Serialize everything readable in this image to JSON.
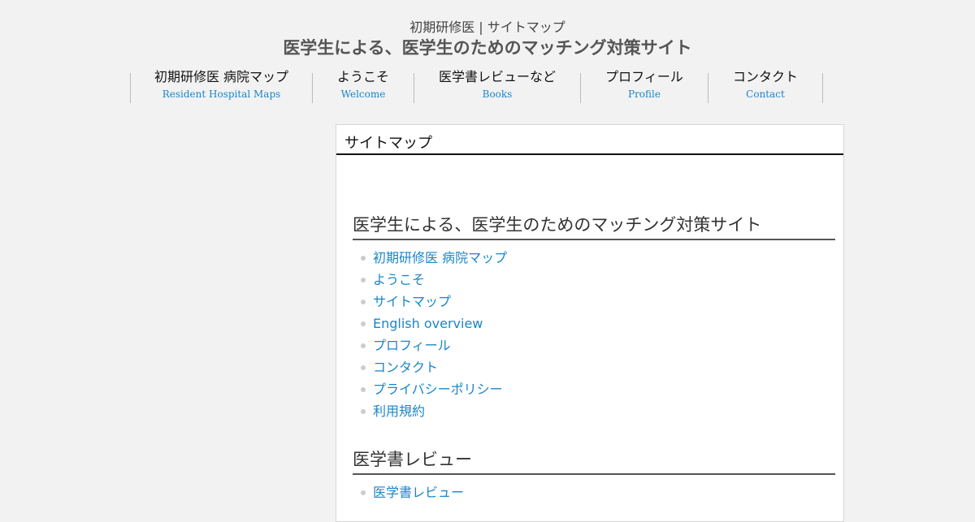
{
  "header": {
    "subtitle": "初期研修医 | サイトマップ",
    "title": "医学生による、医学生のためのマッチング対策サイト"
  },
  "nav": [
    {
      "jp": "初期研修医 病院マップ",
      "en": "Resident Hospital Maps"
    },
    {
      "jp": "ようこそ",
      "en": "Welcome"
    },
    {
      "jp": "医学書レビューなど",
      "en": "Books"
    },
    {
      "jp": "プロフィール",
      "en": "Profile"
    },
    {
      "jp": "コンタクト",
      "en": "Contact"
    }
  ],
  "panel": {
    "heading": "サイトマップ",
    "sections": [
      {
        "title": "医学生による、医学生のためのマッチング対策サイト",
        "links": [
          "初期研修医 病院マップ",
          "ようこそ",
          "サイトマップ",
          "English overview",
          "プロフィール",
          "コンタクト",
          "プライバシーポリシー",
          "利用規約"
        ]
      },
      {
        "title": "医学書レビュー",
        "links": [
          "医学書レビュー"
        ]
      }
    ]
  },
  "colors": {
    "background": "#f2f2f2",
    "link": "#1a86c8",
    "panel": "#ffffff"
  }
}
